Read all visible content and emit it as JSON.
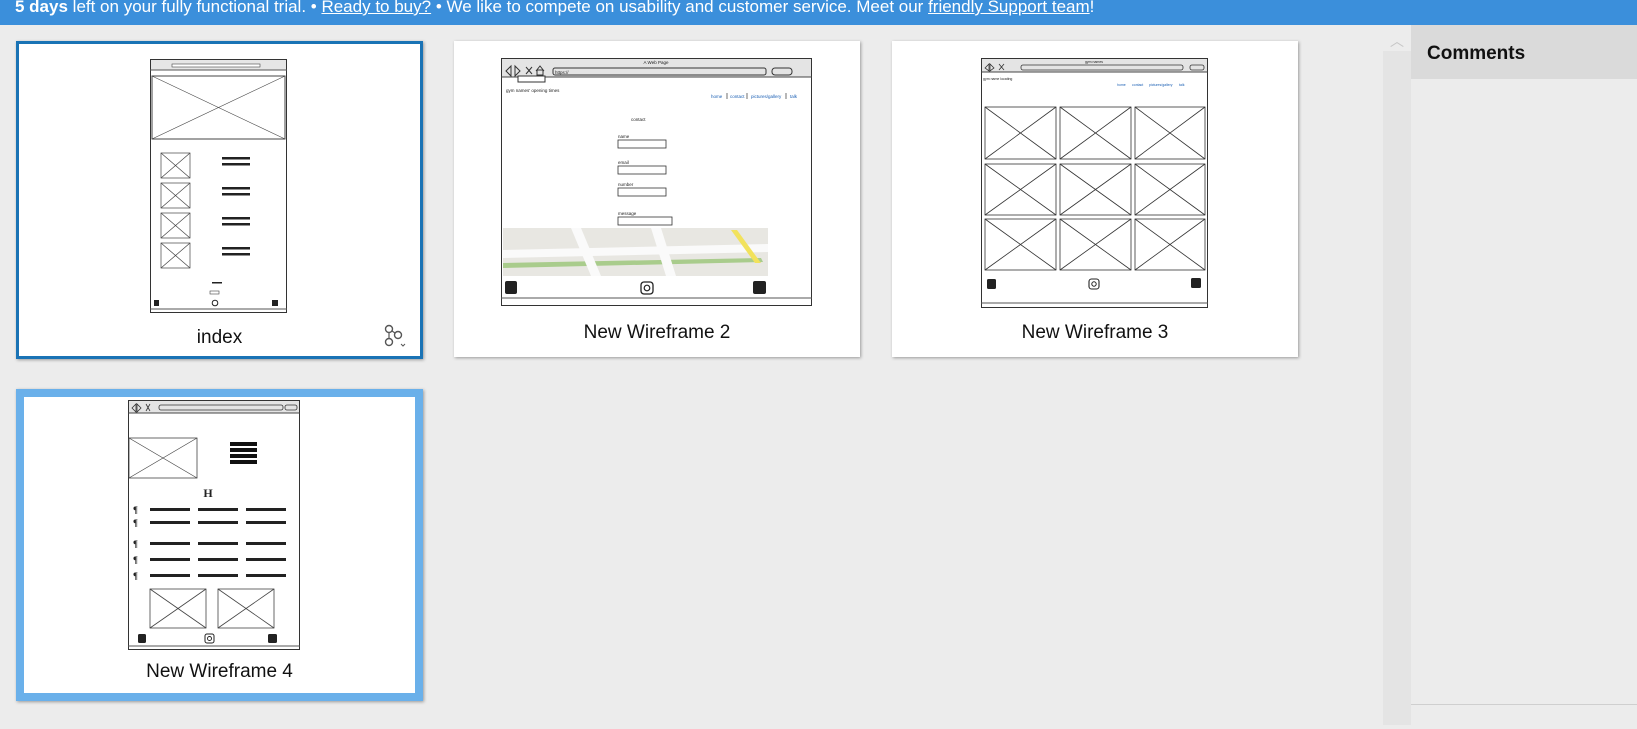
{
  "banner": {
    "days": "5 days",
    "text1": " left on your fully functional trial.  •  ",
    "buy_link": "Ready to buy?",
    "text2": "  •  We like to compete on usability and customer service. Meet our ",
    "support_link": "friendly Support team",
    "text3": "!"
  },
  "sidebar": {
    "title": "Comments"
  },
  "wireframes": [
    {
      "label": "index"
    },
    {
      "label": "New Wireframe 2"
    },
    {
      "label": "New Wireframe 3"
    },
    {
      "label": "New Wireframe 4"
    }
  ],
  "thumbnails": {
    "wf2": {
      "window_title": "A Web Page",
      "url": "https://",
      "site_title": "gym names' opening times",
      "nav": [
        "home",
        "contact",
        "pictures/gallery",
        "talk"
      ],
      "form_title": "contact",
      "fields": [
        "name",
        "email",
        "number",
        "message"
      ]
    },
    "wf3": {
      "window_title": "gym names",
      "site_title": "gym name  locating",
      "nav": [
        "home",
        "contact",
        "pictures/gallery",
        "talk"
      ]
    },
    "wf4": {
      "heading": "H"
    }
  },
  "colors": {
    "banner": "#3b8fdb",
    "selected_border": "#1a73b5",
    "highlight_border": "#6ab0ea",
    "link": "#1a5fb4"
  }
}
